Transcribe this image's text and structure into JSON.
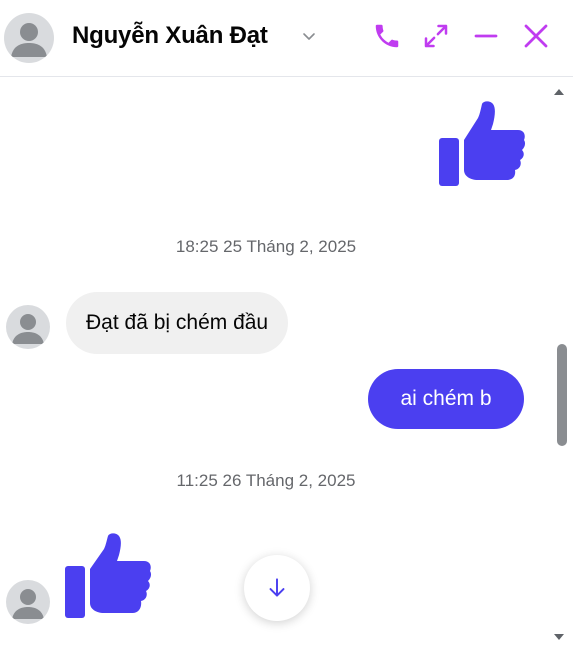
{
  "contact": {
    "name": "Nguyễn Xuân Đạt"
  },
  "header_actions": [
    {
      "name": "call",
      "icon": "phone-icon"
    },
    {
      "name": "expand",
      "icon": "expand-icon"
    },
    {
      "name": "minimize",
      "icon": "minimize-icon"
    },
    {
      "name": "close",
      "icon": "close-icon"
    }
  ],
  "accent_color": "#c03cf0",
  "messages": {
    "timestamp_1": "18:25 25 Tháng 2, 2025",
    "received_1": "Đạt đã bị chém đầu",
    "sent_1": "ai chém b",
    "timestamp_2": "11:25 26 Tháng 2, 2025"
  },
  "colors": {
    "sent_bubble": "#4b3ff0",
    "received_bubble": "#f0f0f0",
    "like_icon": "#4b3ff0"
  }
}
